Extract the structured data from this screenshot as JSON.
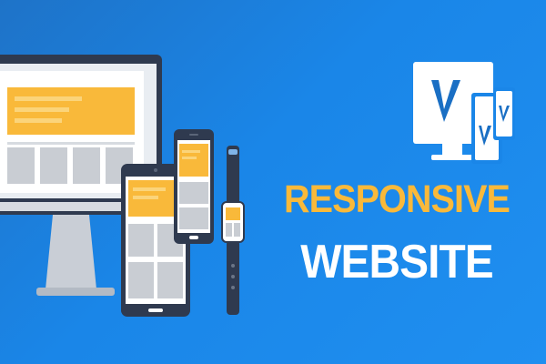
{
  "banner": {
    "headline_line1": "RESPONSIVE",
    "headline_line2": "WEBSITE",
    "logo_letters": [
      "V",
      "V",
      "V"
    ]
  },
  "colors": {
    "background": "#1a86e8",
    "accent_yellow": "#f9b93a",
    "device_frame": "#2f3a4f",
    "screen": "#ffffff",
    "placeholder_gray": "#c9cdd3"
  },
  "illustration": {
    "devices": [
      "desktop-monitor",
      "tablet",
      "smartphone",
      "smartwatch"
    ]
  }
}
